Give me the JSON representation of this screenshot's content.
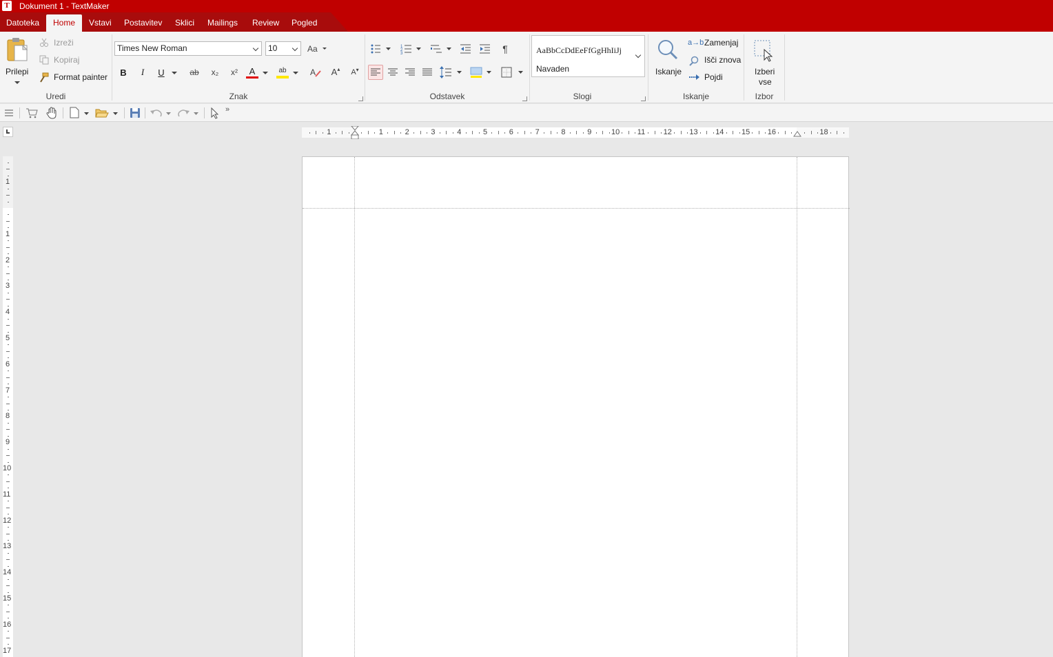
{
  "window": {
    "title": "Dokument 1 - TextMaker",
    "app_icon": "textmaker-logo-icon"
  },
  "menu": {
    "tabs": [
      {
        "label": "Datoteka"
      },
      {
        "label": "Home"
      },
      {
        "label": "Vstavi"
      },
      {
        "label": "Postavitev"
      },
      {
        "label": "Sklici"
      },
      {
        "label": "Mailings"
      },
      {
        "label": "Review"
      },
      {
        "label": "Pogled"
      }
    ],
    "active_tab": "Home"
  },
  "ribbon": {
    "uredi": {
      "label": "Uredi",
      "paste": "Prilepi",
      "cut": "Izreži",
      "copy": "Kopiraj",
      "format_painter": "Format painter"
    },
    "znak": {
      "label": "Znak",
      "font": "Times New Roman",
      "size": "10",
      "bold": "B",
      "italic": "I",
      "underline": "U",
      "strike": "ab",
      "subscript": "x₂",
      "superscript": "x²",
      "font_color_letter": "A",
      "highlight_letters": "ab",
      "grow": "A",
      "shrink": "A"
    },
    "odstavek": {
      "label": "Odstavek",
      "pilcrow": "¶"
    },
    "slogi": {
      "label": "Slogi",
      "sample": "AaBbCcDdEeFfGgHhIiJj",
      "current_style": "Navaden"
    },
    "iskanje": {
      "label": "Iskanje",
      "search": "Iskanje",
      "replace": "Zamenjaj",
      "replace_glyph": "a→b",
      "search_again": "Išči znova",
      "goto": "Pojdi"
    },
    "izbor": {
      "label": "Izbor",
      "select_all_line1": "Izberi",
      "select_all_line2": "vse"
    }
  },
  "colors": {
    "brand_red": "#c00000",
    "font_color": "#e00000",
    "highlight": "#ffe800"
  },
  "rulers": {
    "horizontal_left": [
      "1"
    ],
    "horizontal": [
      "1",
      "2",
      "3",
      "4",
      "5",
      "6",
      "7",
      "8",
      "9",
      "10",
      "11",
      "12",
      "13",
      "14",
      "15",
      "16",
      "18"
    ],
    "vertical_top": [
      "1"
    ],
    "vertical": [
      "1",
      "2",
      "3",
      "4",
      "5",
      "6",
      "7",
      "8",
      "9",
      "10",
      "11",
      "12",
      "13",
      "14",
      "15",
      "16",
      "17"
    ]
  }
}
